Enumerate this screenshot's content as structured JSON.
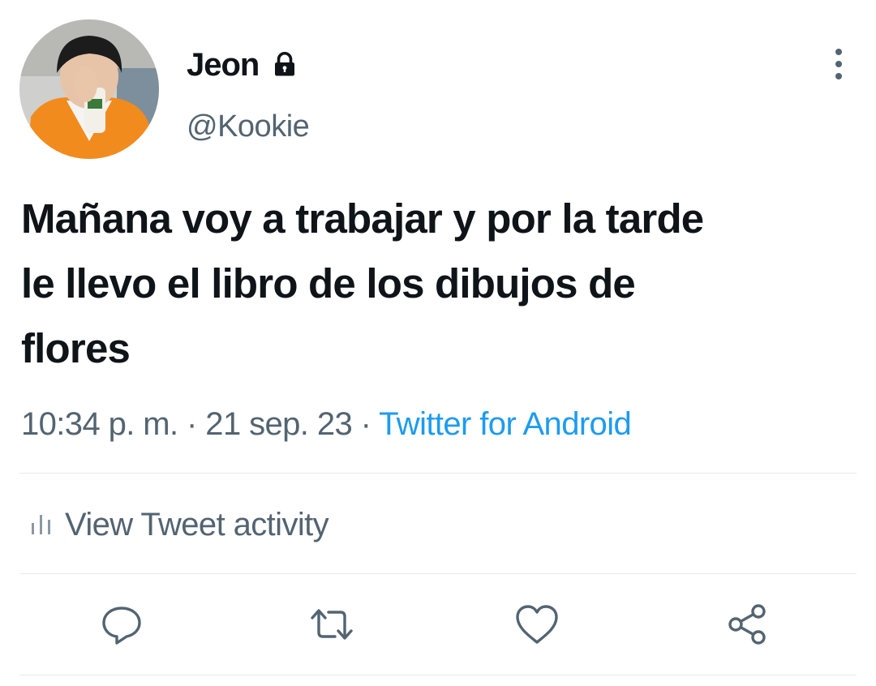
{
  "tweet": {
    "display_name": "Jeon",
    "handle": "@Kookie",
    "text": "Mañana voy a trabajar y por la tarde\nle llevo el libro de los dibujos de\nflores",
    "time": "10:34 p. m.",
    "separator": "·",
    "date": "21 sep. 23",
    "source": "Twitter for Android"
  },
  "activity": {
    "label": "View Tweet activity"
  },
  "icons": {
    "lock": "lock-icon",
    "more": "more-vertical-icon",
    "activity": "bar-chart-icon",
    "reply": "reply-icon",
    "retweet": "retweet-icon",
    "like": "heart-icon",
    "share": "share-icon"
  },
  "colors": {
    "text": "#0f1419",
    "secondary": "#536471",
    "link": "#1d9bf0",
    "divider": "#e7e9eb"
  }
}
